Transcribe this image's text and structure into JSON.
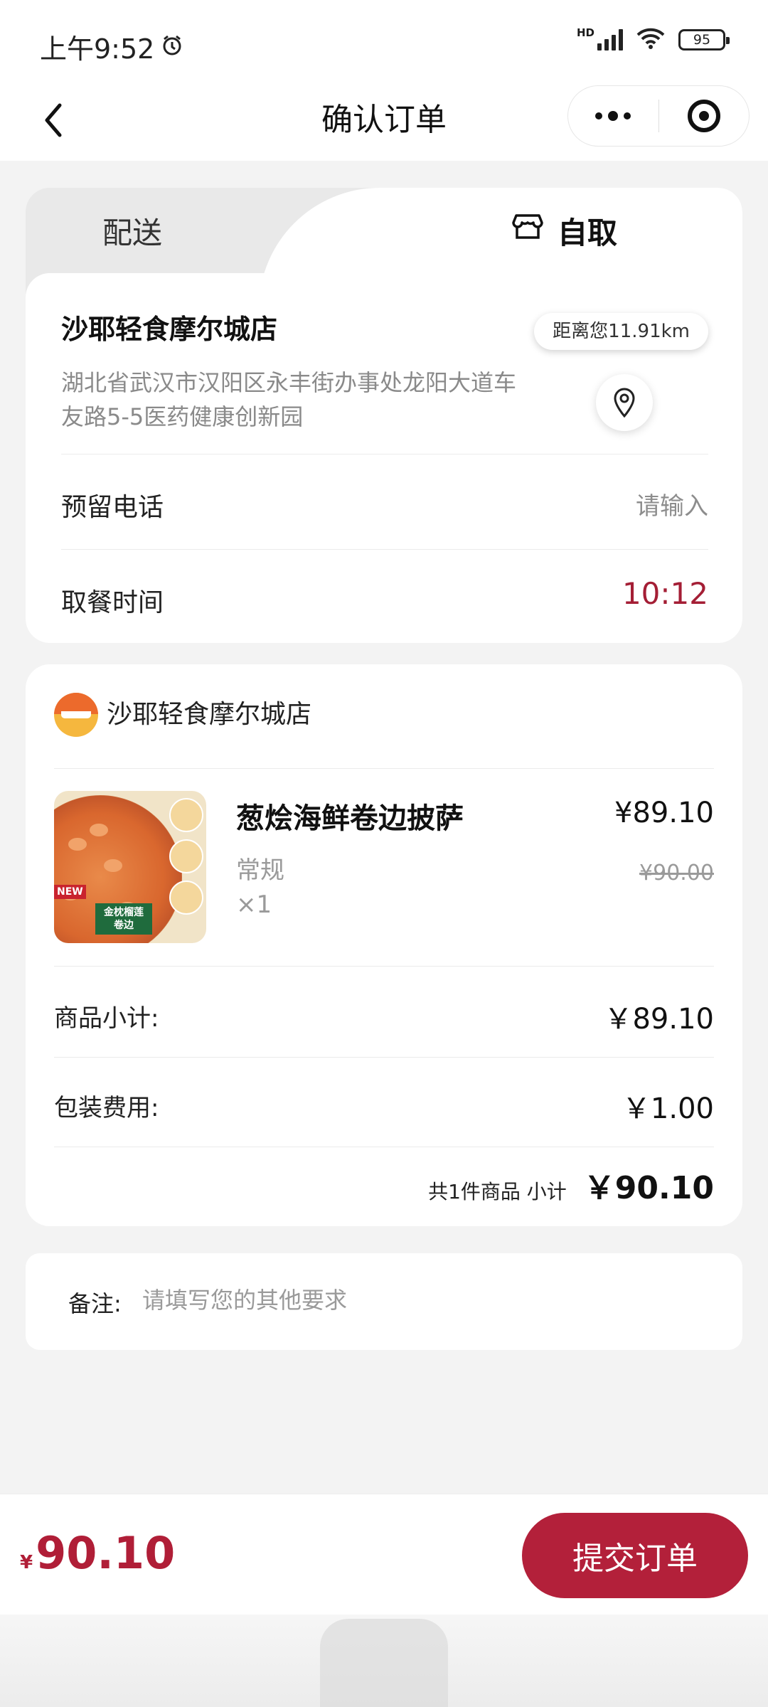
{
  "status_bar": {
    "time": "上午9:52",
    "network_label": "HD",
    "battery": "95",
    "icons": [
      "alarm-icon",
      "signal-icon",
      "wifi-icon",
      "battery-icon"
    ]
  },
  "nav": {
    "title": "确认订单",
    "icons": [
      "back-icon",
      "more-icon",
      "close-icon"
    ]
  },
  "tabs": [
    {
      "label": "配送",
      "active": false
    },
    {
      "label": "自取",
      "active": true,
      "icon": "store-icon"
    }
  ],
  "pickup": {
    "store_name": "沙耶轻食摩尔城店",
    "distance": "距离您11.91km",
    "address": "湖北省武汉市汉阳区永丰街办事处龙阳大道车友路5-5医药健康创新园",
    "phone_label": "预留电话",
    "phone_placeholder": "请输入",
    "time_label": "取餐时间",
    "time_value": "10:12"
  },
  "order": {
    "shop_name": "沙耶轻食摩尔城店",
    "item": {
      "name": "葱烩海鲜卷边披萨",
      "spec": "常规",
      "qty": "×1",
      "price": "¥89.10",
      "original_price": "¥90.00",
      "image_badge_new": "NEW",
      "image_badge_text": "金枕榴莲卷边"
    },
    "subtotal_label": "商品小计:",
    "subtotal_value": "￥89.10",
    "packaging_label": "包装费用:",
    "packaging_value": "￥1.00",
    "summary_text": "共1件商品 小计",
    "summary_total": "￥90.10"
  },
  "note": {
    "label": "备注:",
    "placeholder": "请填写您的其他要求"
  },
  "footer": {
    "currency": "¥",
    "total": "90.10",
    "submit_label": "提交订单"
  },
  "colors": {
    "accent": "#b3203a",
    "time_value": "#a41e35",
    "background": "#f3f3f3"
  }
}
